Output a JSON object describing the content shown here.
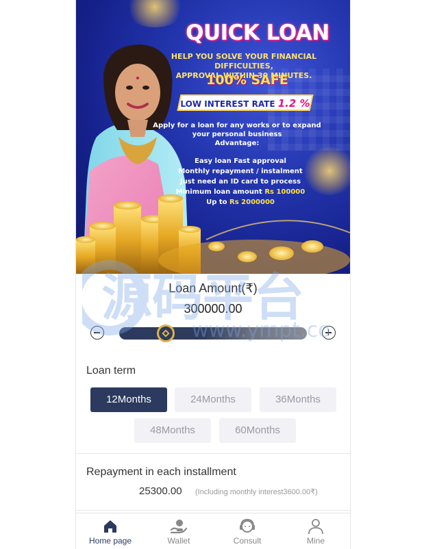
{
  "banner": {
    "title": "QUICK LOAN",
    "subtitle_line1": "HELP YOU SOLVE YOUR FINANCIAL DIFFICULTIES,",
    "subtitle_line2": "APPROVAL WITHIN 30 MINUTES.",
    "safe": "100% SAFE",
    "rate_label": "LOW INTEREST RATE",
    "rate_value": "1.2 %",
    "desc_line1": "Apply for a loan for any works or to expand",
    "desc_line2": "your personal business",
    "desc_line3": "Advantage:",
    "features": [
      "Easy loan Fast approval",
      "Monthly repayment / instalment",
      "Just need an ID card to process"
    ],
    "min_label": "Minimum loan amount ",
    "min_value": "Rs 100000",
    "max_label": "Up to ",
    "max_value": "Rs 2000000"
  },
  "loan": {
    "amount_label": "Loan Amount(₹)",
    "amount_value": "300000.00",
    "slider_fraction": 0.22
  },
  "term": {
    "label": "Loan term",
    "options": [
      "12Months",
      "24Months",
      "36Months",
      "48Months",
      "60Months"
    ],
    "selected": "12Months"
  },
  "repayment": {
    "label": "Repayment in each installment",
    "value": "25300.00",
    "note": "(Including monthly interest3600.00₹)"
  },
  "watermark": {
    "text1": "源码平台",
    "text2": "www.ympt.co"
  },
  "nav": {
    "items": [
      {
        "label": "Home page",
        "icon": "home-icon"
      },
      {
        "label": "Wallet",
        "icon": "wallet-icon"
      },
      {
        "label": "Consult",
        "icon": "consult-icon"
      },
      {
        "label": "Mine",
        "icon": "user-icon"
      }
    ],
    "active": "Home page"
  },
  "colors": {
    "primary": "#2b3a5e",
    "banner_blue": "#2437b0",
    "gold": "#e0b24a"
  }
}
